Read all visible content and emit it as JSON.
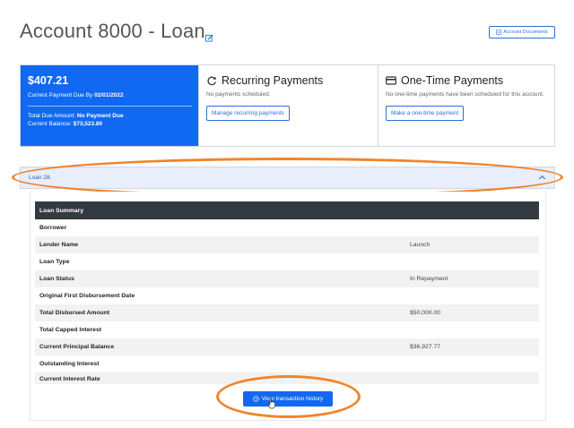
{
  "header": {
    "title": "Account  8000 -  Loan",
    "documents_button": "Account Documents"
  },
  "payment_due": {
    "amount": "$407.21",
    "due_label": "Current Payment Due By ",
    "due_date": "02/01/2022",
    "total_due_label": "Total Due Amount: ",
    "total_due_value": "No Payment Due",
    "balance_label": "Current Balance: ",
    "balance_value": "$73,523.80"
  },
  "recurring": {
    "title": "Recurring Payments",
    "text": "No payments scheduled.",
    "button": "Manage recurring payments"
  },
  "one_time": {
    "title": "One-Time Payments",
    "text": "No one-time payments have been scheduled for this account.",
    "button": "Make a one-time payment"
  },
  "accordion": {
    "label": "Loan 28."
  },
  "summary": {
    "heading": "Loan Summary",
    "rows": [
      {
        "label": "Borrower",
        "value": ""
      },
      {
        "label": "Lender Name",
        "value": "Launch"
      },
      {
        "label": "Loan Type",
        "value": ""
      },
      {
        "label": "Loan Status",
        "value": "In Repayment"
      },
      {
        "label": "Original First Disbursement Date",
        "value": ""
      },
      {
        "label": "Total Disbursed Amount",
        "value": "$50,000.00"
      },
      {
        "label": "Total Capped Interest",
        "value": ""
      },
      {
        "label": "Current Principal Balance",
        "value": "$36,927.77"
      },
      {
        "label": "Outstanding Interest",
        "value": ""
      },
      {
        "label": "Current Interest Rate",
        "value": ""
      }
    ]
  },
  "history_button": "View transaction history",
  "colors": {
    "primary": "#1168f2",
    "highlight": "#f0842a",
    "table_header": "#333a40"
  }
}
